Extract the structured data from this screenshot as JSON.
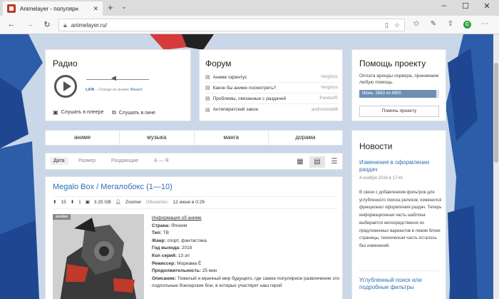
{
  "browser": {
    "tab_title": "Animelayer - популярн",
    "tab_close": "✕",
    "new_tab": "+",
    "tab_menu": "⌄",
    "url": "animelayer.ru/",
    "win_minimize": "–",
    "win_maximize": "☐",
    "win_close": "✕",
    "ext_label": "C"
  },
  "radio": {
    "title": "Радио",
    "station": "LiFB",
    "now_playing_sep": " – Orange из аниме ",
    "now_playing_title": "Bleach",
    "link_player": "Слушать в плеере",
    "link_window": "Слушать в окне"
  },
  "forum": {
    "title": "Форум",
    "topics": [
      {
        "title": "Аниме скринтус",
        "author": "Vergilsss"
      },
      {
        "title": "Какое бы аниме посмотреть?",
        "author": "Vergilsss"
      },
      {
        "title": "Проблемы, связанные с раздачей",
        "author": "PandaXR"
      },
      {
        "title": "Антипиратский закон",
        "author": "andromeda88"
      }
    ]
  },
  "help": {
    "title": "Помощь проекту",
    "text": "Оплата аренды сервера, принимаем любую помощь.",
    "progress_label": "Июнь: 2683 из 4900",
    "progress_raised": 2683,
    "progress_goal": 4900,
    "button": "Помочь проекту"
  },
  "categories": [
    "аниме",
    "музыка",
    "манга",
    "дорама"
  ],
  "sort": {
    "options": [
      "Дата",
      "Размер",
      "Раздающие",
      "А — Я"
    ],
    "active": "Дата"
  },
  "news": {
    "title": "Новости",
    "item1_title": "Изменения в оформлении раздач",
    "item1_date": "4 ноября 2016 в 17:41",
    "item1_body": "В связи с добавлением фильтров для углубленного поиска релизов, изменился функционал оформления раздач. Теперь информационная часть шаблона выбирается непосредственно из предложенных вариантов в левом блоке страницы, техническая часть осталось без изменений.",
    "item2_title": "Углубленный поиск или подробные фильтры"
  },
  "release": {
    "title": "Megalo Box / Мегалобокс (1—10)",
    "seeders": "15",
    "leechers": "1",
    "size": "3.25 GB",
    "uploader": "Zoomer",
    "updated_label": "Обновлён:",
    "updated": "12 июня в 0:29",
    "badge": "аниме",
    "info_link": "Информация об аниме",
    "fields": [
      {
        "k": "Страна:",
        "v": "Япония"
      },
      {
        "k": "Тип:",
        "v": "ТВ"
      },
      {
        "k": "Жанр:",
        "v": "спорт, фантастика"
      },
      {
        "k": "Год выхода:",
        "v": "2018"
      },
      {
        "k": "Кол серий:",
        "v": "13 эп"
      },
      {
        "k": "Режиссер:",
        "v": "Мориама Ё"
      },
      {
        "k": "Продолжительность:",
        "v": "25 мин"
      },
      {
        "k": "Описание:",
        "v": "Тяжелый и мрачный мир будущего, где самое популярное развлечение это подпольные боксерские бои, в которых участвует наш герой"
      }
    ]
  },
  "colors": {
    "accent": "#2f6fb0",
    "page_bg": "#c5d4e6",
    "progress_fill": "#6d8fb4"
  },
  "icons": [
    "lock-icon",
    "star-icon",
    "pen-icon",
    "share-icon",
    "menu-icon",
    "play-icon",
    "speaker-icon",
    "chat-icon",
    "grid-view-icon",
    "list-view-icon",
    "compact-view-icon"
  ]
}
